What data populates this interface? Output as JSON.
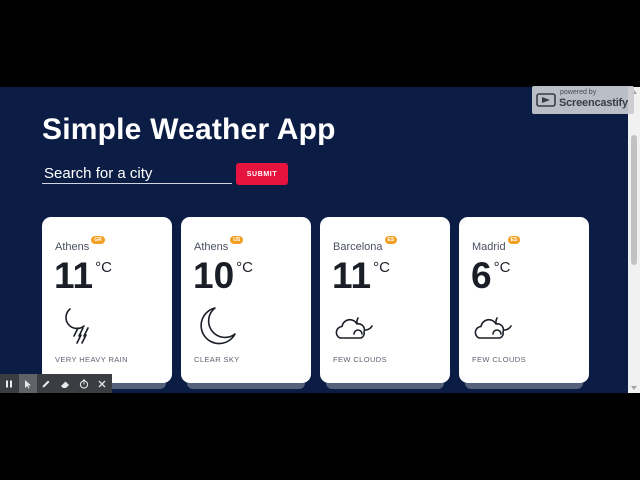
{
  "app": {
    "title": "Simple Weather App"
  },
  "search": {
    "placeholder": "Search for a city",
    "value": "",
    "submit_label": "SUBMIT"
  },
  "cities": [
    {
      "name": "Athens",
      "country": "GR",
      "temp": "11",
      "unit": "°C",
      "description": "VERY HEAVY RAIN",
      "icon": "heavy-rain-icon"
    },
    {
      "name": "Athens",
      "country": "US",
      "temp": "10",
      "unit": "°C",
      "description": "CLEAR SKY",
      "icon": "moon-icon"
    },
    {
      "name": "Barcelona",
      "country": "ES",
      "temp": "11",
      "unit": "°C",
      "description": "FEW CLOUDS",
      "icon": "cloudy-night-icon"
    },
    {
      "name": "Madrid",
      "country": "ES",
      "temp": "6",
      "unit": "°C",
      "description": "FEW CLOUDS",
      "icon": "cloudy-night-icon"
    }
  ],
  "colors": {
    "background": "#0c1d45",
    "card": "#ffffff",
    "accent": "#e5133d",
    "badge": "#f2a023"
  },
  "recorder": {
    "tools": [
      "pause-icon",
      "cursor-icon",
      "pen-icon",
      "eraser-icon",
      "timer-icon",
      "close-icon"
    ]
  },
  "watermark": {
    "small": "powered by",
    "brand": "Screencastify"
  }
}
